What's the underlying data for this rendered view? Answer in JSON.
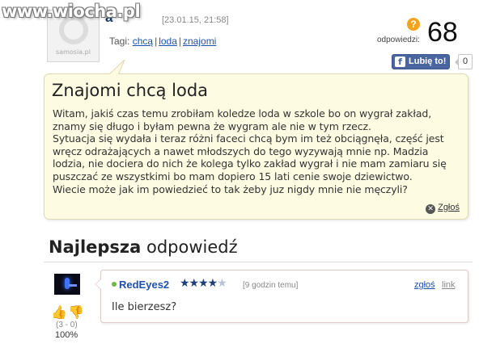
{
  "watermark": {
    "text": "www.wiocha.pl"
  },
  "avatar": {
    "logo_text": "samosia.pl"
  },
  "question": {
    "author_visible": "a",
    "date": "[23.01.15, 21:58]",
    "tags_label": "Tagi:",
    "tags": [
      "chcą",
      "loda",
      "znajomi"
    ],
    "title": "Znajomi chcą loda",
    "body_lines": [
      "Witam, jakiś czas temu zrobiłam koledze loda w szkole bo on wygrał zakład,",
      "znamy się długo i byłam pewna że wygram ale nie w tym rzecz.",
      "Sytuacja się wydała i teraz różni faceci chcą bym im też obciągnęła, część jest",
      "wręcz odrażających a nawet młodszych do tego wyzywają mnie np. Madzia",
      "lodzia, nie dociera do nich że kolega tylko zakład wygrał i nie mam zamiaru się",
      "puszczać ze wszystkimi bo mam dopiero 15 lati cenie swoje dziewictwo.",
      "Wiecie może jak im powiedzieć to tak żeby juz nigdy mnie nie męczyli?"
    ],
    "report_label": "Zgłoś"
  },
  "answers": {
    "icon": "question-mark",
    "label": "odpowiedzi:",
    "count": "68",
    "badge_color": "#f3a41b"
  },
  "like": {
    "label": "Lubię to!",
    "count": "0",
    "icon": "facebook-f"
  },
  "best_answer": {
    "heading_bold": "Najlepsza",
    "heading_rest": " odpowiedź",
    "user": "RedEyes2",
    "stars": "★★★★",
    "star_half": "★",
    "time": "[9 godzin temu]",
    "report_label": "zgłoś",
    "link_label": "link",
    "text": "Ile bierzesz?",
    "votes_ratio": "(3 - 0)",
    "votes_pct": "100%"
  }
}
